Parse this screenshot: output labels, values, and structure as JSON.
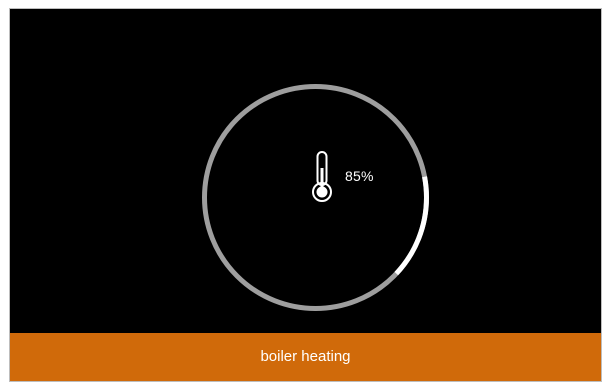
{
  "device": {
    "value_percent": 85,
    "value_label": "85%",
    "status_label": "boiler heating",
    "icon": "thermometer-icon"
  },
  "colors": {
    "background": "#000000",
    "ring_track": "#9e9e9e",
    "ring_fill": "#ffffff",
    "status_bar": "#d06a0a",
    "text": "#ffffff"
  }
}
